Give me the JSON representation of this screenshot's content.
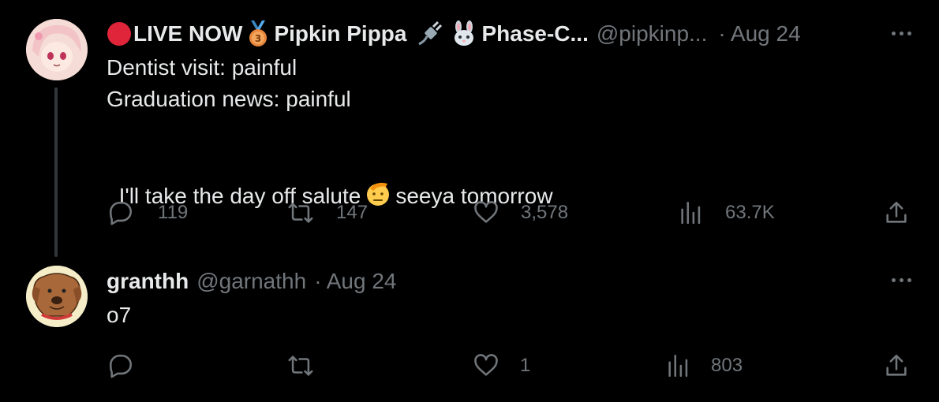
{
  "tweet1": {
    "display_name_prefix": "LIVE NOW",
    "display_name_main": "Pipkin Pippa",
    "display_name_suffix": "Phase-C...",
    "handle": "@pipkinp...",
    "time": "· Aug 24",
    "lines": [
      "Dentist visit: painful",
      "Graduation news: painful"
    ],
    "last_line_before": "I'll take the day off salute",
    "last_line_after": "seeya tomorrow",
    "replies": "119",
    "retweets": "147",
    "likes": "3,578",
    "views": "63.7K"
  },
  "tweet2": {
    "display_name": "granthh",
    "handle": "@garnathh",
    "time": "· Aug 24",
    "text": "o7",
    "replies": "",
    "retweets": "",
    "likes": "1",
    "views": "803"
  },
  "icons": {
    "live_dot": "red-circle-icon",
    "medal": "third-place-medal-icon",
    "plug": "plug-icon",
    "rabbit": "rabbit-icon",
    "salute": "saluting-face-icon"
  },
  "colors": {
    "background": "#000000",
    "text": "#e7e9ea",
    "muted": "#71767b",
    "thread_line": "#333639",
    "live_red": "#e0243a"
  }
}
